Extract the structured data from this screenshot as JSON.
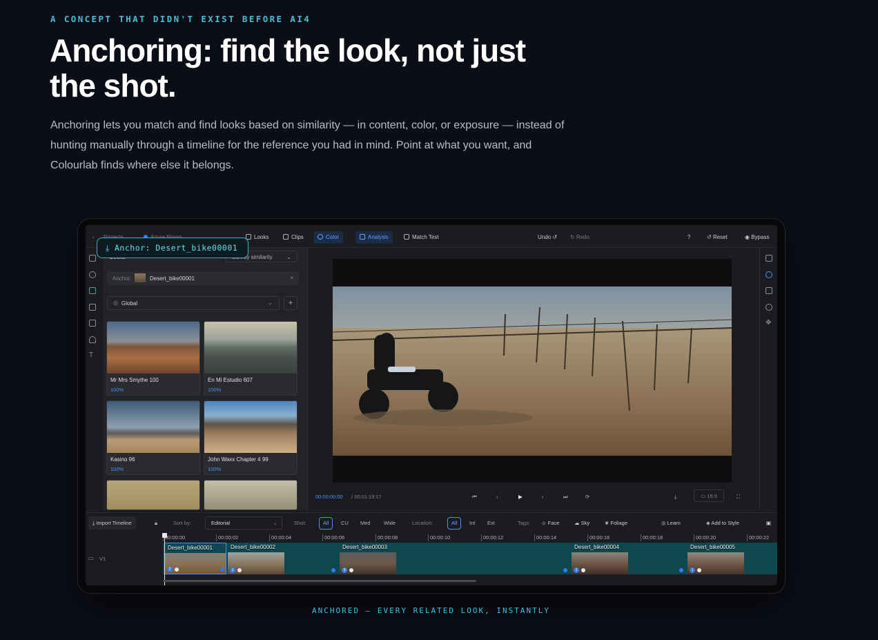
{
  "hero": {
    "eyebrow": "A CONCEPT THAT DIDN'T EXIST BEFORE AI4",
    "title": "Anchoring: find the look, not just the shot.",
    "body": "Anchoring lets you match and find looks based on similarity — in content, color, or exposure — instead of hunting manually through a timeline for the reference you had in mind. Point at what you want, and Colourlab finds where else it belongs.",
    "caption": "ANCHORED — EVERY RELATED LOOK, INSTANTLY"
  },
  "anchor_tag": "⤓ Anchor: Desert_bike00001",
  "app": {
    "breadcrumb": {
      "projects": "Projects",
      "project": "Azure Bloom"
    },
    "toolbar": {
      "looks": "Looks",
      "clips": "Clips",
      "color": "Color",
      "analysis": "Analysis",
      "match_test": "Match Test",
      "undo": "Undo",
      "redo": "Redo",
      "reset": "Reset",
      "bypass": "Bypass"
    },
    "looks_panel": {
      "title": "Looks",
      "sort": "Sort by similarity",
      "anchor_label": "Anchor:",
      "anchor_name": "Desert_bike00001",
      "scope": "Global",
      "cards": [
        {
          "title": "Mr Mrs Smythe 100",
          "score": "100%"
        },
        {
          "title": "En Mi Estudio 607",
          "score": "100%"
        },
        {
          "title": "Kasino 96",
          "score": "100%"
        },
        {
          "title": "John Waxx Chapter 4 99",
          "score": "100%"
        }
      ]
    },
    "viewer": {
      "timecode": "00:00:00:00",
      "duration": "/ 00:01:19:17",
      "aspect": "16:9"
    },
    "timeline_bar": {
      "import": "Import Timeline",
      "sort_by_label": "Sort by:",
      "sort_by_value": "Editorial",
      "shot_label": "Shot:",
      "shot_options": [
        "All",
        "CU",
        "Med",
        "Wide"
      ],
      "location_label": "Location:",
      "location_options": [
        "All",
        "Int",
        "Ext"
      ],
      "tags_label": "Tags:",
      "tags": [
        "Face",
        "Sky",
        "Foliage"
      ],
      "learn": "Learn",
      "add_to_style": "Add to Style"
    },
    "ruler": [
      "00:00:00",
      "00:00:02",
      "00:00:04",
      "00:00:06",
      "00:00:08",
      "00:00:10",
      "00:00:12",
      "00:00:14",
      "00:00:16",
      "00:00:18",
      "00:00:20",
      "00:00:22"
    ],
    "track_label": "V1",
    "clips": [
      {
        "name": "Desert_bike00001",
        "badge": "2"
      },
      {
        "name": "Desert_bike00002",
        "badge": "1"
      },
      {
        "name": "Desert_bike00003",
        "badge": "3"
      },
      {
        "name": "Desert_bike00004",
        "badge": "1"
      },
      {
        "name": "Desert_bike00005",
        "badge": "1"
      }
    ]
  }
}
